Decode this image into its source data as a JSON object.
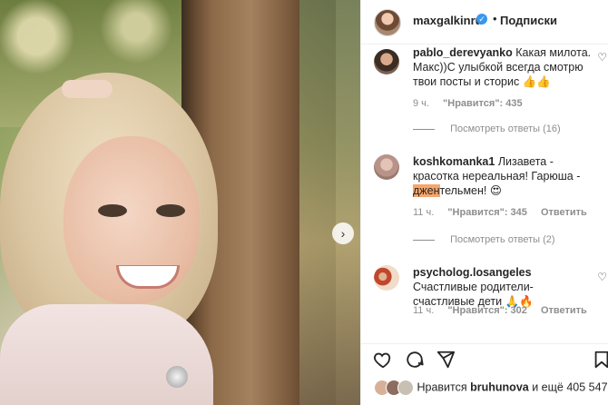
{
  "post": {
    "carousel_next_icon": "chevron-right-icon"
  },
  "header": {
    "username": "maxgalkinru",
    "verified_icon": "verified-badge-icon",
    "separator": "•",
    "follow_label": "Подписки"
  },
  "comments": [
    {
      "username": "pablo_derevyanko",
      "text": "Какая милота. Макс))С улыбкой всегда смотрю твои посты и сторис 👍👍",
      "time": "9 ч.",
      "likes": "\"Нравится\": 435",
      "reply_label": "",
      "replies": "Посмотреть ответы (16)"
    },
    {
      "username": "koshkomanka1",
      "text_before": "Лизавета - красотка нереальная! Гарюша - ",
      "text_highlight": "джен",
      "text_after": "тельмен! 😍",
      "time": "11 ч.",
      "likes": "\"Нравится\": 345",
      "reply_label": "Ответить",
      "replies": "Посмотреть ответы (2)"
    },
    {
      "username": "psycholog.losangeles",
      "text": "Счастливые родители- счастливые дети 🙏🔥",
      "time": "11 ч.",
      "likes": "\"Нравится\": 302",
      "reply_label": "Ответить"
    }
  ],
  "likes": {
    "prefix": "Нравится",
    "user": "bruhunova",
    "suffix": "и ещё 405 547"
  },
  "colors": {
    "verified": "#3897f0",
    "highlight": "#f7a56b"
  }
}
